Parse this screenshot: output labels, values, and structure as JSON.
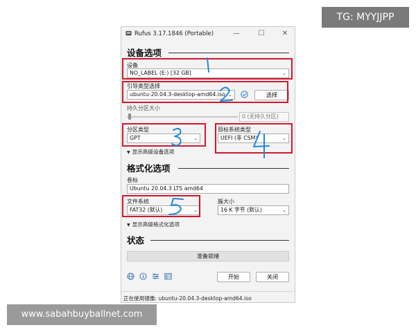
{
  "watermarks": {
    "top_right": "TG: MYYJJPP",
    "bottom_left": "www.sabahbuyballnet.com"
  },
  "window": {
    "title": "Rufus 3.17.1846 (Portable)",
    "controls": {
      "minimize": "—",
      "maximize": "☐",
      "close": "✕"
    }
  },
  "drive": {
    "section_title": "设备选项",
    "device_label": "设备",
    "device_value": "NO_LABEL (E:) [32 GB]",
    "boot_label": "引导类型选择",
    "boot_value": "ubuntu-20.04.3-desktop-amd64.iso",
    "select_button": "选择",
    "persistent_label": "持久分区大小",
    "persistent_value": "0 (无持久分区)",
    "partition_label": "分区类型",
    "partition_value": "GPT",
    "target_label": "目标系统类型",
    "target_value": "UEFI (非 CSM)",
    "advanced_drive": "显示高级设备选项"
  },
  "format": {
    "section_title": "格式化选项",
    "volume_label": "卷标",
    "volume_value": "Ubuntu 20.04.3 LTS amd64",
    "fs_label": "文件系统",
    "fs_value": "FAT32 (默认)",
    "cluster_label": "簇大小",
    "cluster_value": "16 K 字节 (默认)",
    "advanced_format": "显示高级格式化选项"
  },
  "status": {
    "section_title": "状态",
    "progress_text": "准备就绪",
    "start_button": "开始",
    "close_button": "关闭",
    "footer_text": "正在使用镜像: ubuntu-20.04.3-desktop-amd64.iso"
  },
  "annotations": [
    "1",
    "2",
    "3",
    "4",
    "5"
  ],
  "colors": {
    "highlight": "#d0182c",
    "annotation": "#1e88d8",
    "accent": "#2a7bd4"
  },
  "icons": [
    "globe-icon",
    "info-icon",
    "settings-sliders-icon",
    "log-icon",
    "check-hash-icon"
  ]
}
